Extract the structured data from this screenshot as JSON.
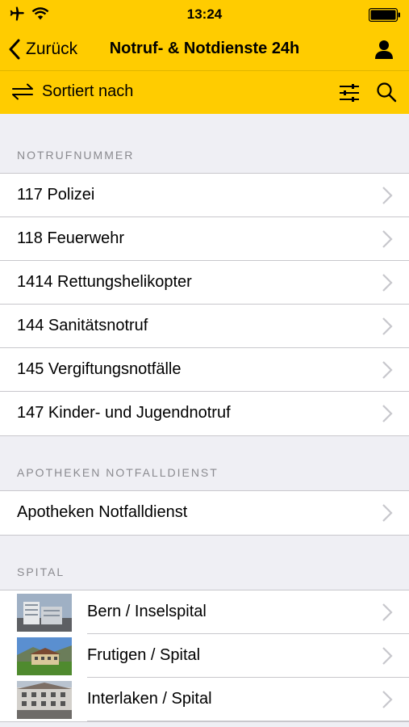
{
  "status": {
    "time": "13:24"
  },
  "nav": {
    "back_label": "Zurück",
    "title": "Notruf- & Notdienste 24h"
  },
  "toolbar": {
    "sort_label": "Sortiert nach"
  },
  "sections": {
    "notruf": {
      "header": "NOTRUFNUMMER",
      "items": [
        {
          "label": "117 Polizei"
        },
        {
          "label": "118 Feuerwehr"
        },
        {
          "label": "1414 Rettungshelikopter"
        },
        {
          "label": "144 Sanitätsnotruf"
        },
        {
          "label": "145 Vergiftungsnotfälle"
        },
        {
          "label": "147 Kinder- und Jugendnotruf"
        }
      ]
    },
    "apotheken": {
      "header": "APOTHEKEN NOTFALLDIENST",
      "items": [
        {
          "label": "Apotheken Notfalldienst"
        }
      ]
    },
    "spital": {
      "header": "SPITAL",
      "items": [
        {
          "label": "Bern / Inselspital"
        },
        {
          "label": "Frutigen / Spital"
        },
        {
          "label": "Interlaken / Spital"
        }
      ]
    }
  },
  "colors": {
    "accent": "#ffcc00",
    "chevron": "#c7c7cc",
    "section_text": "#8a8a8f"
  }
}
